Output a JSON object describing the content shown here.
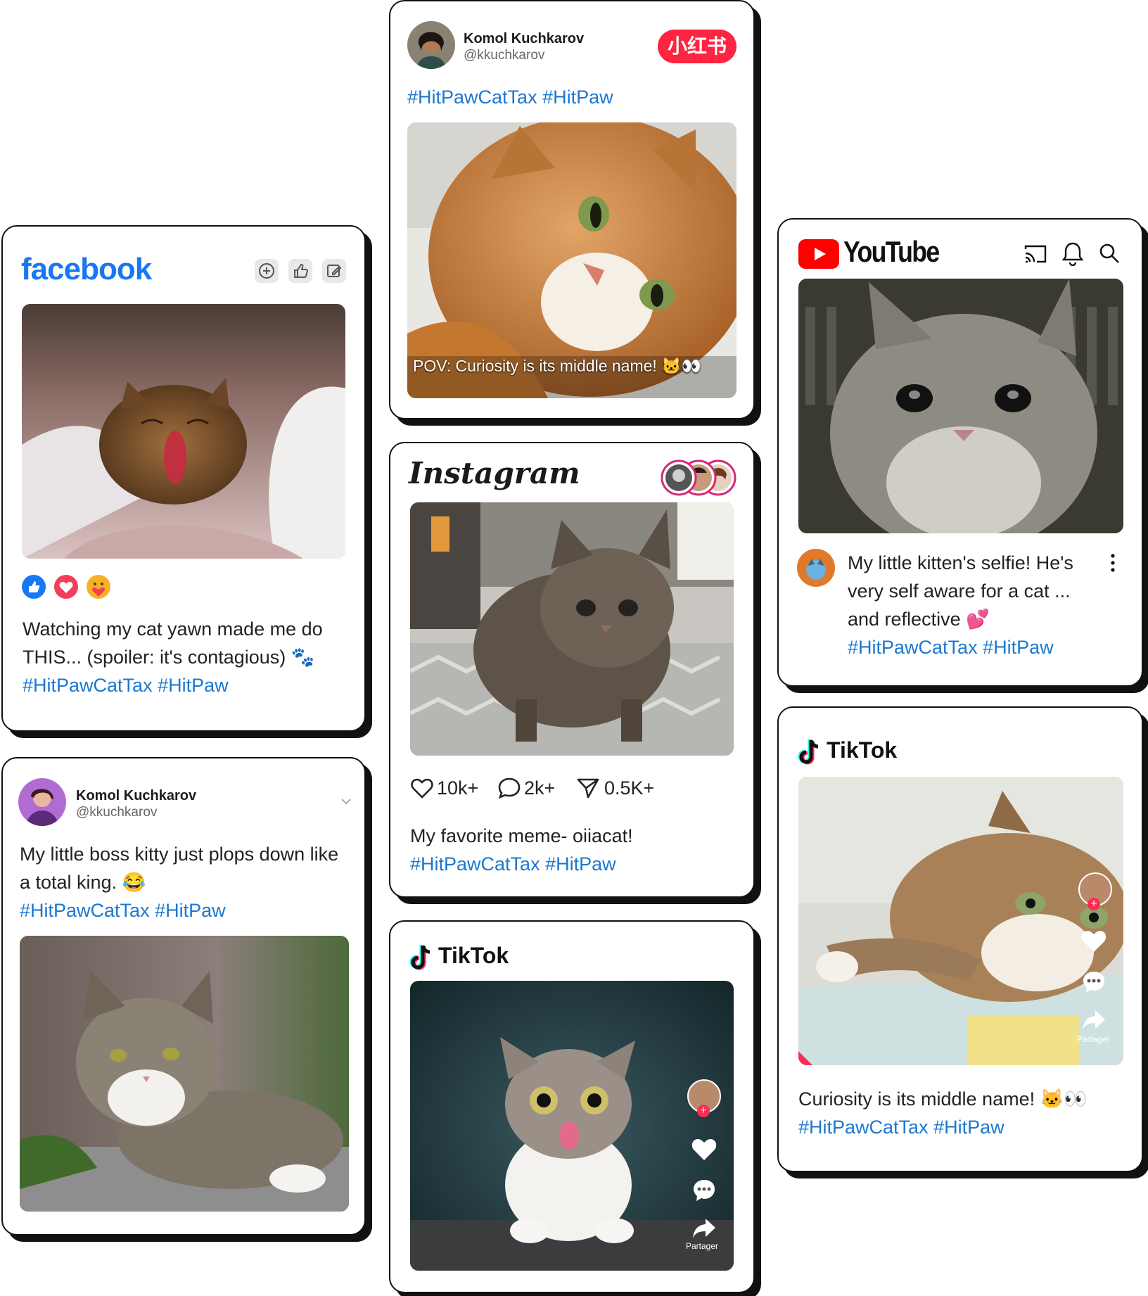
{
  "facebook": {
    "logo": "facebook",
    "icons": [
      "plus-circle-icon",
      "thumbs-up-icon",
      "edit-icon"
    ],
    "reactions": [
      "like-reaction-icon",
      "love-reaction-icon",
      "care-reaction-icon"
    ],
    "caption_1": "Watching my cat yawn made me do",
    "caption_2": "THIS... (spoiler: it's contagious) 🐾",
    "tags": "#HitPawCatTax #HitPaw"
  },
  "twitter_post": {
    "name": "Komol Kuchkarov",
    "handle": "@kkuchkarov",
    "caption_1": "My little boss kitty just plops down like",
    "caption_2": "a total king. 😂",
    "tags": "#HitPawCatTax #HitPaw"
  },
  "xiaohongshu": {
    "name": "Komol Kuchkarov",
    "handle": "@kkuchkarov",
    "badge": "小红书",
    "tags": "#HitPawCatTax #HitPaw",
    "overlay": "POV: Curiosity is its middle name! 🐱👀"
  },
  "instagram": {
    "logo": "Instagram",
    "likes": "10k+",
    "comments": "2k+",
    "shares": "0.5K+",
    "caption": "My favorite meme- oiiacat!",
    "tags": "#HitPawCatTax #HitPaw"
  },
  "tiktok_center": {
    "logo": "TikTok",
    "share_label": "Partager"
  },
  "youtube": {
    "logo": "YouTube",
    "caption_1": "My little kitten's selfie! He's",
    "caption_2": "very self aware for a cat ...",
    "caption_3": "and reflective 💕",
    "tags": "#HitPawCatTax #HitPaw"
  },
  "tiktok_right": {
    "logo": "TikTok",
    "share_label": "Partager",
    "caption": "Curiosity is its middle name! 🐱👀",
    "tags": "#HitPawCatTax #HitPaw"
  },
  "colors": {
    "hashtag": "#1b78d0",
    "facebook_blue": "#1877f2",
    "youtube_red": "#ff0000",
    "xhs_red": "#ff2442"
  }
}
